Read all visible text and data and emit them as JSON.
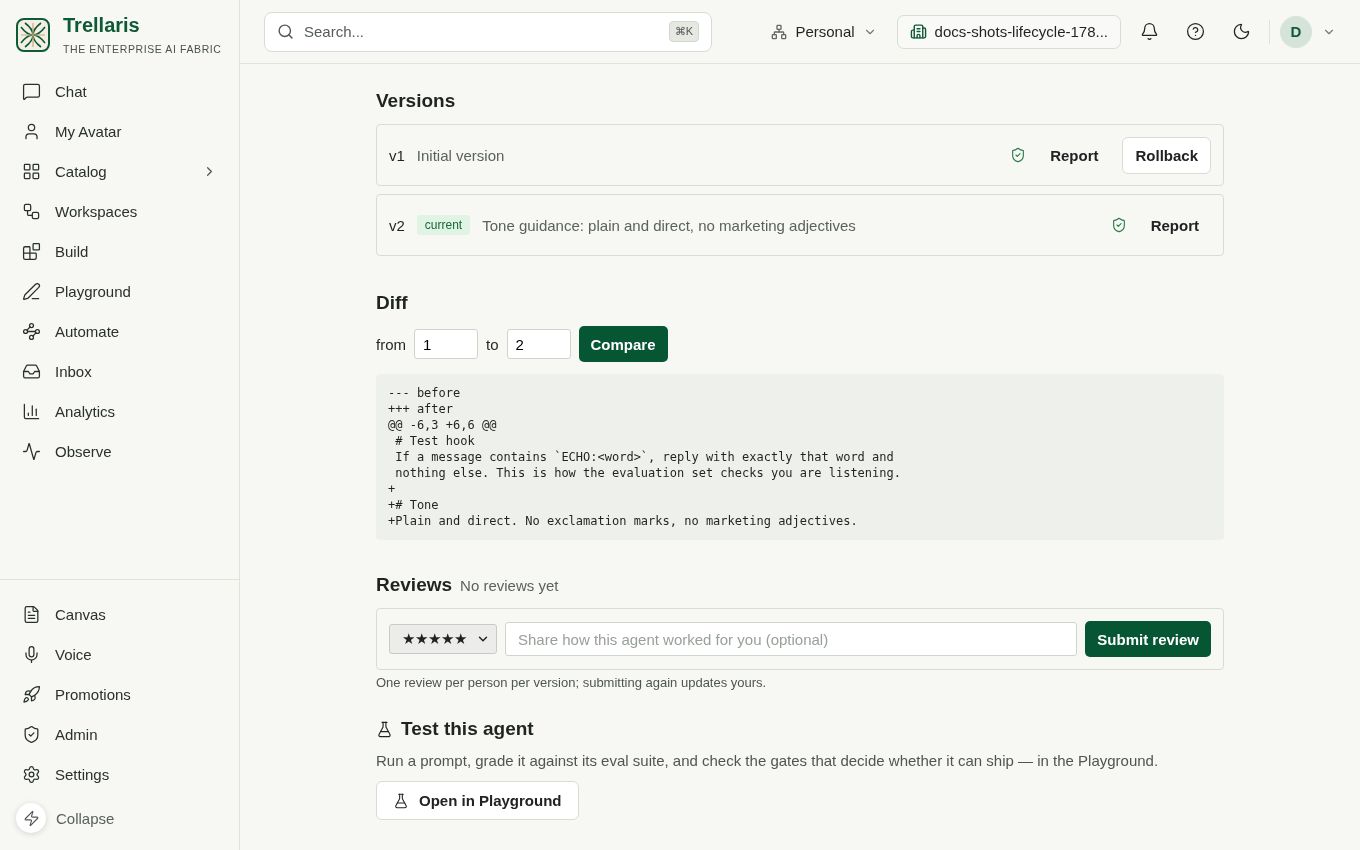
{
  "brand": {
    "name": "Trellaris",
    "tagline": "THE ENTERPRISE AI FABRIC"
  },
  "sidebar": {
    "items": [
      {
        "label": "Chat",
        "expandable": false
      },
      {
        "label": "My Avatar",
        "expandable": false
      },
      {
        "label": "Catalog",
        "expandable": true
      },
      {
        "label": "Workspaces",
        "expandable": false
      },
      {
        "label": "Build",
        "expandable": false
      },
      {
        "label": "Playground",
        "expandable": false
      },
      {
        "label": "Automate",
        "expandable": false
      },
      {
        "label": "Inbox",
        "expandable": false
      },
      {
        "label": "Analytics",
        "expandable": false
      },
      {
        "label": "Observe",
        "expandable": false
      }
    ],
    "bottom_items": [
      {
        "label": "Canvas"
      },
      {
        "label": "Voice"
      },
      {
        "label": "Promotions"
      },
      {
        "label": "Admin"
      },
      {
        "label": "Settings"
      }
    ],
    "collapse": "Collapse"
  },
  "header": {
    "search": {
      "placeholder": "Search...",
      "shortcut": "⌘K"
    },
    "scope": "Personal",
    "workspace": "docs-shots-lifecycle-178...",
    "avatar": "D"
  },
  "versions": {
    "title": "Versions",
    "items": [
      {
        "version": "v1",
        "description": "Initial version",
        "actions": [
          "Report",
          "Rollback"
        ]
      },
      {
        "version": "v2",
        "badge": "current",
        "description": "Tone guidance: plain and direct, no marketing adjectives",
        "actions": [
          "Report"
        ]
      }
    ]
  },
  "diff": {
    "title": "Diff",
    "from_label": "from",
    "from": "1",
    "to_label": "to",
    "to": "2",
    "button": "Compare",
    "lines": [
      "--- before",
      "+++ after",
      "@@ -6,3 +6,6 @@",
      " # Test hook",
      " If a message contains `ECHO:<word>`, reply with exactly that word and",
      " nothing else. This is how the evaluation set checks you are listening.",
      "+",
      "+# Tone",
      "+Plain and direct. No exclamation marks, no marketing adjectives."
    ]
  },
  "reviews": {
    "title": "Reviews",
    "status": "No reviews yet",
    "rating": "★★★★★",
    "placeholder": "Share how this agent worked for you (optional)",
    "button": "Submit review",
    "note": "One review per person per version; submitting again updates yours."
  },
  "test": {
    "title": "Test this agent",
    "description": "Run a prompt, grade it against its eval suite, and check the gates that decide whether it can ship — in the Playground.",
    "button": "Open in Playground"
  }
}
